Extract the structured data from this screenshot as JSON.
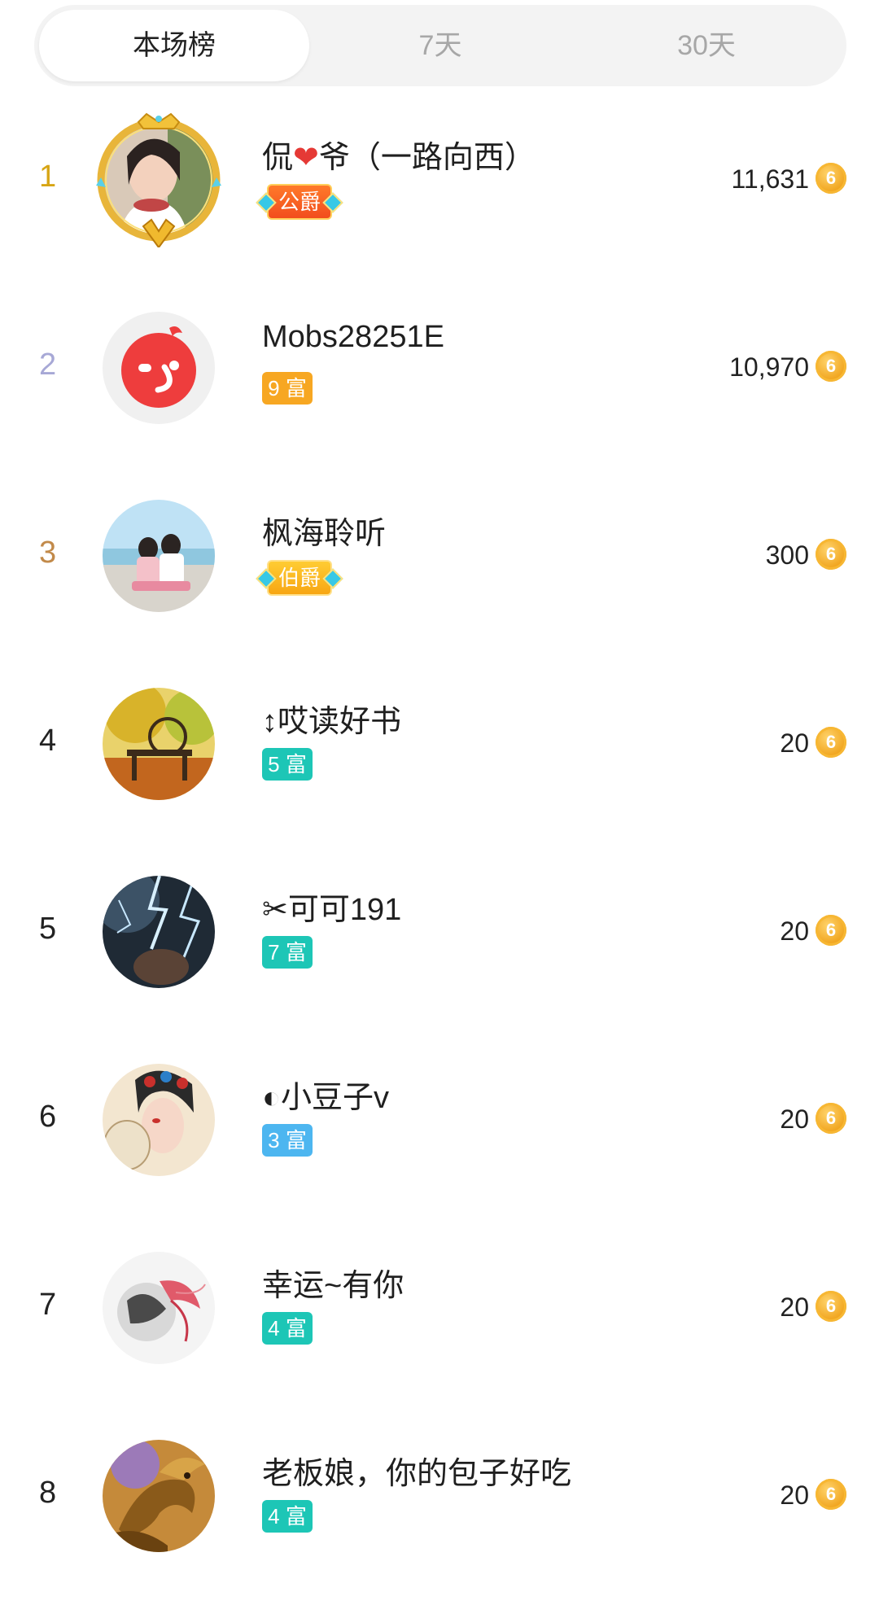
{
  "tabs": [
    {
      "label": "本场榜",
      "active": true
    },
    {
      "label": "7天",
      "active": false
    },
    {
      "label": "30天",
      "active": false
    }
  ],
  "ranking": [
    {
      "rank": "1",
      "name_prefix": "侃",
      "name_heart": "❤",
      "name_suffix": "爷（一路向西）",
      "badge": "公爵",
      "badge_type": "duke",
      "score": "11,631",
      "avatar": "woman-portrait"
    },
    {
      "rank": "2",
      "name": "Mobs28251E",
      "badge": "9 富",
      "badge_color": "#f7a722",
      "score": "10,970",
      "avatar": "red-wink-logo"
    },
    {
      "rank": "3",
      "name": "枫海聆听",
      "badge": "伯爵",
      "badge_type": "earl",
      "score": "300",
      "avatar": "beach-couple"
    },
    {
      "rank": "4",
      "name": "↕哎读好书",
      "badge": "5 富",
      "badge_color": "#1dc6b6",
      "score": "20",
      "avatar": "autumn-bench"
    },
    {
      "rank": "5",
      "name": "✂可可191",
      "badge": "7 富",
      "badge_color": "#1dc6b6",
      "score": "20",
      "avatar": "lightning-storm"
    },
    {
      "rank": "6",
      "name": "◐小豆子v",
      "badge": "3 富",
      "badge_color": "#4db6f0",
      "score": "20",
      "avatar": "opera-lady"
    },
    {
      "rank": "7",
      "name": "幸运~有你",
      "badge": "4 富",
      "badge_color": "#1dc6b6",
      "score": "20",
      "avatar": "ink-flower"
    },
    {
      "rank": "8",
      "name": "老板娘，你的包子好吃",
      "badge": "4 富",
      "badge_color": "#1dc6b6",
      "score": "20",
      "avatar": "golden-dragon"
    }
  ],
  "coin_glyph": "6",
  "colors": {
    "rank1": "#d7a514",
    "rank2": "#a7a8d6",
    "rank3": "#c28a4a",
    "coin": "#f0a31c"
  }
}
